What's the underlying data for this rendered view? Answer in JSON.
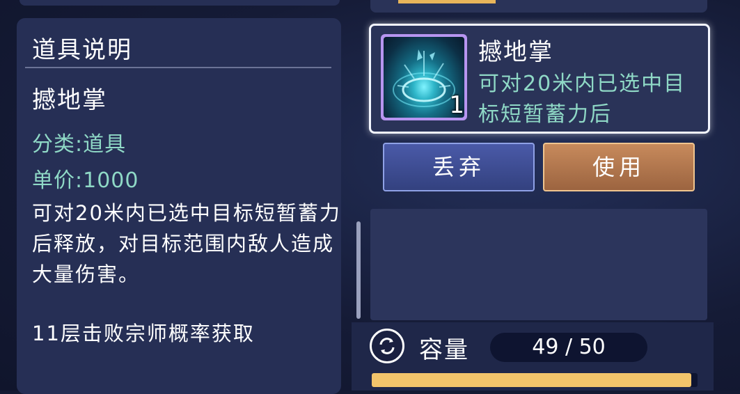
{
  "colors": {
    "panel": "#262f55",
    "accent_teal": "#8fd9c6",
    "gold": "#f2c46b",
    "discard_blue": "#3f4e97",
    "use_orange": "#b7794e"
  },
  "description_panel": {
    "title": "道具说明",
    "item_name": "撼地掌",
    "category": "分类:道具",
    "price": "单价:1000",
    "body": "可对20米内已选中目标短暂蓄力后释放，对目标范围内敌人造成大量伤害。",
    "source": "11层击败宗师概率获取"
  },
  "selected_item": {
    "name": "撼地掌",
    "description": "可对20米内已选中目标短暂蓄力后",
    "count": "1",
    "icon": "shockwave-palm-icon"
  },
  "actions": {
    "discard_label": "丢弃",
    "use_label": "使用"
  },
  "capacity": {
    "label": "容量",
    "text": "49 / 50",
    "used": 49,
    "max": 50,
    "icon": "refresh-icon"
  }
}
